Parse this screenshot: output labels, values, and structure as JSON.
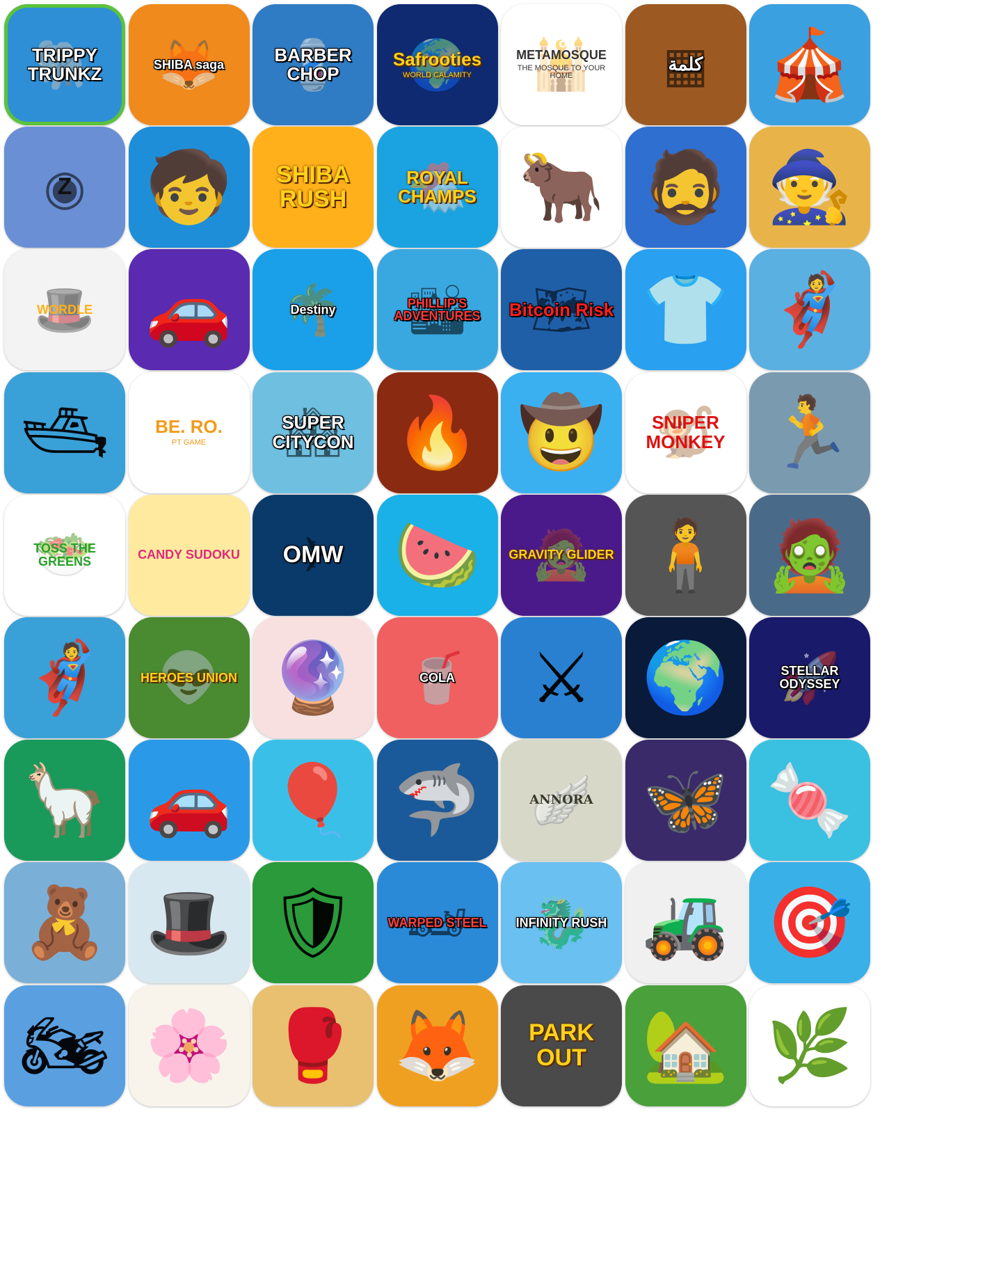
{
  "apps": [
    {
      "label": "TRIPPY TRUNKZ",
      "bg": "#2e8fd6",
      "fg": "#ffffff",
      "glyph": "🐘",
      "style": "stroke med",
      "border": "#5cc23a"
    },
    {
      "label": "SHIBA saga",
      "bg": "#f08a1c",
      "fg": "#ffffff",
      "glyph": "🦊",
      "style": "stroke small"
    },
    {
      "label": "BARBER CHOP",
      "bg": "#2f7cc4",
      "fg": "#ffffff",
      "glyph": "💈",
      "style": "stroke med"
    },
    {
      "label": "Safrooties",
      "sub": "WORLD CALAMITY",
      "bg": "#0f2a70",
      "fg": "#ffd11a",
      "glyph": "🌍",
      "style": "yellow med"
    },
    {
      "label": "METAMOSQUE",
      "sub": "THE MOSQUE TO YOUR HOME",
      "bg": "#ffffff",
      "fg": "#333333",
      "glyph": "🕌",
      "style": "dark small"
    },
    {
      "label": "كلمة",
      "bg": "#9c5a22",
      "fg": "#ffffff",
      "glyph": "▦",
      "style": "stroke med"
    },
    {
      "label": "",
      "bg": "#3aa0e0",
      "fg": "#ffffff",
      "glyph": "🎪",
      "style": "stroke med"
    },
    {
      "label": "Z",
      "bg": "#6b8fd4",
      "fg": "#111111",
      "glyph": "◉",
      "style": "dark big"
    },
    {
      "label": "",
      "bg": "#1f8ed8",
      "fg": "#ffffff",
      "glyph": "🧒",
      "style": "stroke med"
    },
    {
      "label": "SHIBA RUSH",
      "bg": "#ffb01a",
      "fg": "#ffd11a",
      "glyph": "",
      "style": "yellow big"
    },
    {
      "label": "ROYAL CHAMPS",
      "bg": "#1aa3e0",
      "fg": "#ffd11a",
      "glyph": "🐔",
      "style": "yellow med"
    },
    {
      "label": "",
      "bg": "#ffffff",
      "fg": "#333333",
      "glyph": "🐂",
      "style": "dark big"
    },
    {
      "label": "",
      "bg": "#2f6fd0",
      "fg": "#ffffff",
      "glyph": "🧔",
      "style": "stroke med"
    },
    {
      "label": "",
      "bg": "#e8b44a",
      "fg": "#ffffff",
      "glyph": "🧙",
      "style": "stroke med"
    },
    {
      "label": "WORDLE",
      "bg": "#f3f3f3",
      "fg": "#ffb01a",
      "glyph": "🎩",
      "style": "dark small"
    },
    {
      "label": "",
      "bg": "#5a2ab0",
      "fg": "#ffffff",
      "glyph": "🚗",
      "style": "stroke med"
    },
    {
      "label": "Destiny",
      "bg": "#1aa0e8",
      "fg": "#ffffff",
      "glyph": "🌴",
      "style": "stroke small"
    },
    {
      "label": "PHILLIP'S ADVENTURES",
      "bg": "#3aa8e0",
      "fg": "#ff3a3a",
      "glyph": "🏙",
      "style": "stroke small"
    },
    {
      "label": "Bitcoin Risk",
      "bg": "#1f5fa8",
      "fg": "#ff2020",
      "glyph": "🗺",
      "style": "stroke med"
    },
    {
      "label": "",
      "bg": "#2aa0f0",
      "fg": "#ffffff",
      "glyph": "👕",
      "style": "stroke med"
    },
    {
      "label": "",
      "bg": "#5ab0e0",
      "fg": "#ffffff",
      "glyph": "🦸",
      "style": "stroke med"
    },
    {
      "label": "",
      "bg": "#3aa0d8",
      "fg": "#ffffff",
      "glyph": "🛥",
      "style": "stroke med"
    },
    {
      "label": "BE. RO.",
      "sub": "PT GAME",
      "bg": "#ffffff",
      "fg": "#f39a1a",
      "glyph": "",
      "style": "dark med"
    },
    {
      "label": "SUPER CITYCON",
      "bg": "#6fbfe0",
      "fg": "#ffffff",
      "glyph": "🏘",
      "style": "stroke med"
    },
    {
      "label": "",
      "bg": "#8a2a10",
      "fg": "#ffffff",
      "glyph": "🔥",
      "style": "stroke med"
    },
    {
      "label": "",
      "bg": "#3ab0f0",
      "fg": "#ffffff",
      "glyph": "🤠",
      "style": "stroke med"
    },
    {
      "label": "SNIPER MONKEY",
      "bg": "#ffffff",
      "fg": "#d11111",
      "glyph": "🐒",
      "style": "red med"
    },
    {
      "label": "",
      "bg": "#7a9ab0",
      "fg": "#ffffff",
      "glyph": "🏃",
      "style": "stroke med"
    },
    {
      "label": "TOSS THE GREENS",
      "bg": "#ffffff",
      "fg": "#2aa02a",
      "glyph": "🥗",
      "style": "dark small"
    },
    {
      "label": "CANDY SUDOKU",
      "bg": "#ffeaa0",
      "fg": "#e02a7a",
      "glyph": "",
      "style": "dark small"
    },
    {
      "label": "OMW",
      "bg": "#0a3a6a",
      "fg": "#ffffff",
      "glyph": "✈",
      "style": "stroke big"
    },
    {
      "label": "",
      "bg": "#1ab0e8",
      "fg": "#ffffff",
      "glyph": "🍉",
      "style": "stroke med"
    },
    {
      "label": "GRAVITY GLIDER",
      "bg": "#4a1a8a",
      "fg": "#ffd11a",
      "glyph": "🧟",
      "style": "yellow small"
    },
    {
      "label": "",
      "bg": "#555555",
      "fg": "#ffffff",
      "glyph": "🧍",
      "style": "stroke med"
    },
    {
      "label": "",
      "bg": "#4a6a8a",
      "fg": "#ffffff",
      "glyph": "🧟",
      "style": "stroke med"
    },
    {
      "label": "",
      "bg": "#3aa0d8",
      "fg": "#ffffff",
      "glyph": "🦸",
      "style": "stroke med"
    },
    {
      "label": "HEROES UNION",
      "bg": "#4a8a30",
      "fg": "#ffd11a",
      "glyph": "👽",
      "style": "yellow small"
    },
    {
      "label": "",
      "bg": "#f8e0e0",
      "fg": "#ffffff",
      "glyph": "🔮",
      "style": "stroke med"
    },
    {
      "label": "COLA",
      "bg": "#f06060",
      "fg": "#ffffff",
      "glyph": "🥤",
      "style": "stroke small"
    },
    {
      "label": "",
      "bg": "#2a80d0",
      "fg": "#ffffff",
      "glyph": "⚔",
      "style": "stroke big"
    },
    {
      "label": "",
      "bg": "#0a1a3a",
      "fg": "#ffffff",
      "glyph": "🌍",
      "style": "stroke med"
    },
    {
      "label": "STELLAR ODYSSEY",
      "bg": "#1a1a6a",
      "fg": "#ffffff",
      "glyph": "🚀",
      "style": "stroke small"
    },
    {
      "label": "",
      "bg": "#1a9a5a",
      "fg": "#ffffff",
      "glyph": "🦙",
      "style": "stroke med"
    },
    {
      "label": "",
      "bg": "#2a9ae8",
      "fg": "#ffffff",
      "glyph": "🚗",
      "style": "stroke med"
    },
    {
      "label": "",
      "bg": "#3ac0e8",
      "fg": "#ffffff",
      "glyph": "🎈",
      "style": "stroke med"
    },
    {
      "label": "",
      "bg": "#1a5a9a",
      "fg": "#ffffff",
      "glyph": "🦈",
      "style": "stroke med"
    },
    {
      "label": "ANNORA",
      "bg": "#d8d8c8",
      "fg": "#3a3a2a",
      "glyph": "🪽",
      "style": "dark small serif"
    },
    {
      "label": "",
      "bg": "#3a2a6a",
      "fg": "#ffffff",
      "glyph": "🦋",
      "style": "stroke med"
    },
    {
      "label": "",
      "bg": "#3ac0e0",
      "fg": "#ffffff",
      "glyph": "🍬",
      "style": "stroke med"
    },
    {
      "label": "",
      "bg": "#7ab0d8",
      "fg": "#ffffff",
      "glyph": "🧸",
      "style": "stroke med"
    },
    {
      "label": "",
      "bg": "#d8e8f0",
      "fg": "#ffffff",
      "glyph": "🎩",
      "style": "stroke med"
    },
    {
      "label": "",
      "bg": "#2a9a3a",
      "fg": "#ffffff",
      "glyph": "🛡",
      "style": "stroke big"
    },
    {
      "label": "WARPED STEEL",
      "bg": "#2a8ad8",
      "fg": "#ff4040",
      "glyph": "🏎",
      "style": "stroke small"
    },
    {
      "label": "INFINITY RUSH",
      "bg": "#6ac0f0",
      "fg": "#ffffff",
      "glyph": "🐉",
      "style": "stroke small"
    },
    {
      "label": "",
      "bg": "#f0f0f0",
      "fg": "#ffffff",
      "glyph": "🚜",
      "style": "stroke med"
    },
    {
      "label": "",
      "bg": "#3ab0e8",
      "fg": "#ffffff",
      "glyph": "🎯",
      "style": "stroke med"
    },
    {
      "label": "",
      "bg": "#5aa0e0",
      "fg": "#ffffff",
      "glyph": "🏍",
      "style": "stroke med"
    },
    {
      "label": "",
      "bg": "#f8f4ec",
      "fg": "#ffffff",
      "glyph": "🌸",
      "style": "stroke med"
    },
    {
      "label": "",
      "bg": "#e8c070",
      "fg": "#ffffff",
      "glyph": "🥊",
      "style": "stroke med"
    },
    {
      "label": "",
      "bg": "#f0a020",
      "fg": "#ffffff",
      "glyph": "🦊",
      "style": "stroke med"
    },
    {
      "label": "PARK OUT",
      "bg": "#4a4a4a",
      "fg": "#ffd11a",
      "glyph": "",
      "style": "yellow big"
    },
    {
      "label": "",
      "bg": "#4aa03a",
      "fg": "#ffffff",
      "glyph": "🏡",
      "style": "stroke med"
    },
    {
      "label": "",
      "bg": "#ffffff",
      "fg": "#ffffff",
      "glyph": "🌿",
      "style": "stroke med"
    }
  ]
}
